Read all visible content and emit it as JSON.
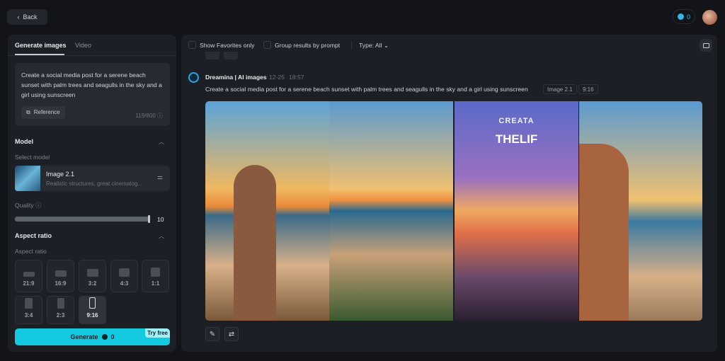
{
  "header": {
    "back_label": "Back",
    "credits": "0"
  },
  "left": {
    "tabs": [
      {
        "label": "Generate images",
        "active": true
      },
      {
        "label": "Video",
        "active": false
      }
    ],
    "prompt": "Create a social media post for a serene beach sunset with palm trees and seagulls in the sky and a girl using sunscreen",
    "reference_label": "Reference",
    "char_count": "119/800",
    "model_section": "Model",
    "select_model_label": "Select model",
    "model": {
      "name": "Image 2.1",
      "description": "Realistic structures, great cinematog..."
    },
    "quality_label": "Quality",
    "quality_value": "10",
    "aspect_section": "Aspect ratio",
    "aspect_label": "Aspect ratio",
    "aspect_ratios": [
      "21:9",
      "16:9",
      "3:2",
      "4:3",
      "1:1",
      "3:4",
      "2:3",
      "9:16"
    ],
    "selected_ratio": "9:16",
    "generate_label": "Generate",
    "generate_cost": "0",
    "try_free": "Try free",
    "accent_color": "#12c9e0"
  },
  "main": {
    "filters": {
      "favorites": "Show Favorites only",
      "group": "Group results by prompt",
      "type": "Type: All"
    },
    "result": {
      "author": "Dreamina | AI images",
      "date": "12-25",
      "time": "18:57",
      "prompt": "Create a social media post for a serene beach sunset with palm trees and seagulls in the sky and a girl using sunscreen",
      "model_tag": "Image 2.1",
      "ratio_tag": "9:16"
    },
    "poster_text": {
      "line1": "CREATA",
      "line2": "THELIF"
    }
  }
}
